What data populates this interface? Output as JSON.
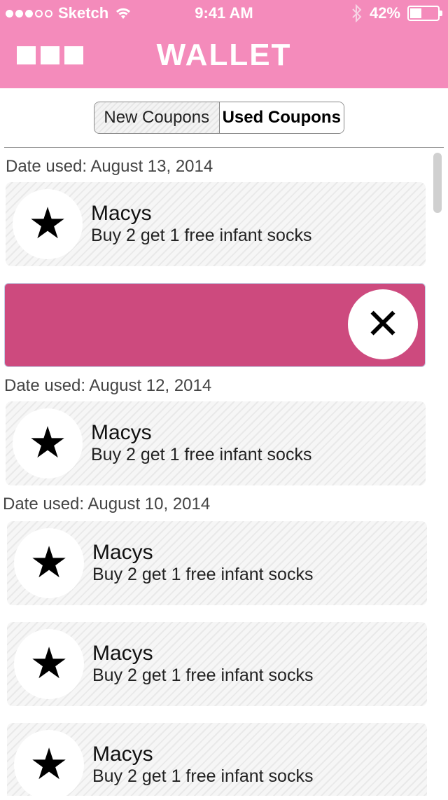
{
  "status": {
    "carrier": "Sketch",
    "time": "9:41 AM",
    "battery": "42%",
    "battery_level": 0.42,
    "signal_bars": 3,
    "signal_total": 5
  },
  "header": {
    "title": "WALLET"
  },
  "tabs": {
    "new": "New Coupons",
    "used": "Used Coupons",
    "selected": "used"
  },
  "groups": [
    {
      "date": "Date used: August 13, 2014",
      "coupons": [
        {
          "store": "Macys",
          "offer": "Buy 2 get 1 free infant socks"
        }
      ]
    },
    {
      "date": "Date used: August 12, 2014",
      "coupons": [
        {
          "store": "Macys",
          "offer": "Buy 2 get 1 free infant socks"
        }
      ]
    },
    {
      "date": "Date used: August 10, 2014",
      "coupons": [
        {
          "store": "Macys",
          "offer": "Buy 2 get 1 free infant socks"
        },
        {
          "store": "Macys",
          "offer": "Buy 2 get 1 free infant socks"
        },
        {
          "store": "Macys",
          "offer": "Buy 2 get 1 free infant socks"
        }
      ]
    }
  ],
  "icons": {
    "coupon": "star-icon",
    "delete": "close-icon",
    "menu": "menu-icon"
  },
  "colors": {
    "header": "#f48bbb",
    "swipe_delete": "#cd4a7e"
  }
}
